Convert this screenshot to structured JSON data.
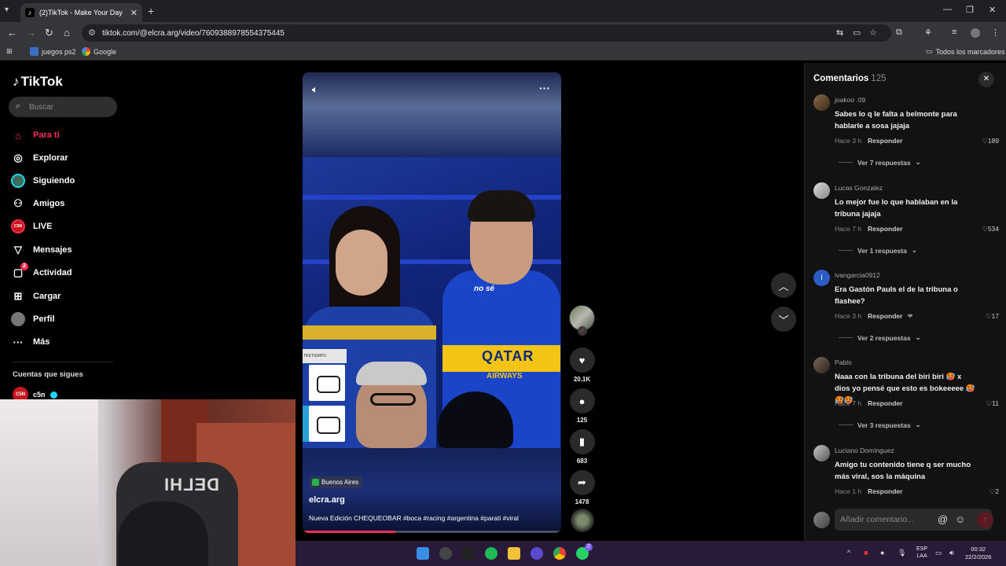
{
  "browser": {
    "tab_title": "(2)TikTok - Make Your Day",
    "tab_favicon": "tiktok-icon",
    "url": "tiktok.com/@elcra.arg/video/7609388978554375445",
    "bookmarks": [
      {
        "label": "juegos ps2"
      },
      {
        "label": "Google"
      }
    ],
    "all_bookmarks": "Todos los marcadores"
  },
  "sidebar": {
    "logo": "TikTok",
    "search_placeholder": "Buscar",
    "items": [
      {
        "label": "Para ti",
        "icon": "home-icon",
        "active": true
      },
      {
        "label": "Explorar",
        "icon": "compass-icon"
      },
      {
        "label": "Siguiendo",
        "icon": "following-avatar-icon"
      },
      {
        "label": "Amigos",
        "icon": "friends-icon"
      },
      {
        "label": "LIVE",
        "icon": "live-icon"
      },
      {
        "label": "Mensajes",
        "icon": "send-icon"
      },
      {
        "label": "Actividad",
        "icon": "activity-icon",
        "badge": "2"
      },
      {
        "label": "Cargar",
        "icon": "upload-icon"
      },
      {
        "label": "Perfil",
        "icon": "profile-avatar-icon"
      },
      {
        "label": "Más",
        "icon": "more-icon"
      }
    ],
    "following_title": "Cuentas que sigues",
    "following": [
      {
        "name": "c5n",
        "avatar_text": "C5N"
      }
    ]
  },
  "video": {
    "location": "Buenos Aires",
    "author": "elcra.arg",
    "caption": "Nueva Edición CHEQUEOBAR #boca #racing #argentina #parati #viral",
    "overlay_text": "no sé",
    "shirt_sponsor": "QATAR",
    "shirt_sponsor_sub": "AIRWAYS",
    "tv_bar": "TRETIEMPO",
    "progress": 0.36
  },
  "actions": {
    "likes": "20.1K",
    "comments": "125",
    "saves": "683",
    "shares": "1478"
  },
  "comments_panel": {
    "title": "Comentarios",
    "count": "125",
    "input_placeholder": "Añadir comentario...",
    "reply_label": "Responder",
    "items": [
      {
        "user": "joakoo .09",
        "text": "Sabes lo q le falta a belmonte para hablarle a sosa jajaja",
        "time": "Hace 3 h",
        "likes": "189",
        "replies": "Ver 7 respuestas"
      },
      {
        "user": "Lucas Gonzalez",
        "text": "Lo mejor fue lo que hablaban en la tribuna jajaja",
        "time": "Hace 7 h",
        "likes": "534",
        "replies": "Ver 1 respuesta"
      },
      {
        "user": "ivangarcia0912",
        "text": "Era Gastón Pauls el de la tribuna o flashee?",
        "time": "Hace 3 h",
        "likes": "17",
        "replies": "Ver 2 respuestas",
        "avatar_letter": "I"
      },
      {
        "user": "Pablo",
        "text": "Naaa con la tribuna del biri biri 🥵 x dios yo pensé que esto es bokeeeee 🥵🥵🥵",
        "time": "Hace 7 h",
        "likes": "11",
        "replies": "Ver 3 respuestas"
      },
      {
        "user": "Luciano Domínguez",
        "text": "Amigo tu contenido tiene q ser mucho más viral, sos la máquina",
        "time": "Hace 1 h",
        "likes": "2"
      }
    ]
  },
  "webcam": {
    "chair_logo": "DELHI"
  },
  "taskbar": {
    "lang_top": "ESP",
    "lang_bottom": "LAA",
    "time": "00:32",
    "date": "22/2/2026",
    "whatsapp_badge": "2"
  }
}
